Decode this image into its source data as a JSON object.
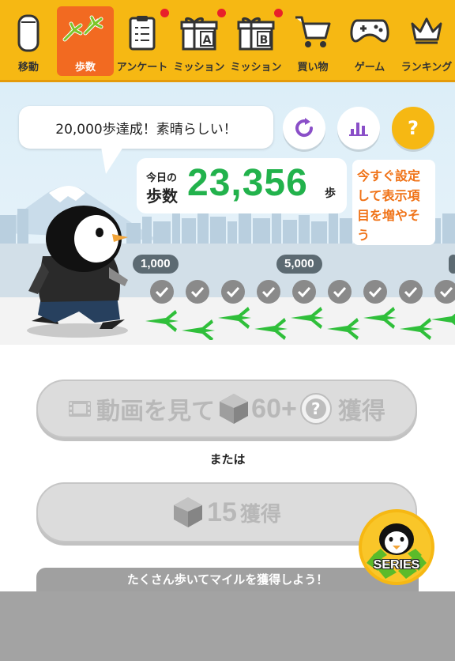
{
  "tabs": [
    {
      "label": "移動",
      "icon": "phone-icon"
    },
    {
      "label": "歩数",
      "icon": "footprints-icon",
      "active": true
    },
    {
      "label": "アンケート",
      "icon": "clipboard-icon",
      "badge": true
    },
    {
      "label": "ミッション",
      "icon": "gift-a-icon",
      "badge": true
    },
    {
      "label": "ミッション",
      "icon": "gift-b-icon",
      "badge": true
    },
    {
      "label": "買い物",
      "icon": "cart-icon"
    },
    {
      "label": "ゲーム",
      "icon": "gamepad-icon"
    },
    {
      "label": "ランキング",
      "icon": "crown-icon"
    }
  ],
  "bubble": {
    "text": "20,000歩達成！素晴らしい！"
  },
  "steps": {
    "label_line1": "今日の",
    "label_line2": "歩数",
    "value": "23,356",
    "unit": "歩"
  },
  "buttons": {
    "refresh_icon": "refresh-icon",
    "stats_icon": "bar-chart-icon",
    "help_label": "?"
  },
  "hint": {
    "line1": "今すぐ設定",
    "line2": "して表示項",
    "line3": "目を増やそ",
    "line4": "う"
  },
  "milestones": {
    "m1": "1,000",
    "m2": "5,000"
  },
  "video_button": {
    "label_prefix": "動画を見て",
    "amount": "60+",
    "help": "?",
    "suffix": "獲得"
  },
  "or_text": "または",
  "gem_button": {
    "amount": "15",
    "suffix": "獲得"
  },
  "banner": {
    "text": "たくさん歩いてマイルを獲得しよう！"
  },
  "series_badge": {
    "label": "SERIES"
  },
  "colors": {
    "accent": "#f6b813",
    "active_tab": "#f26a21",
    "steps_green": "#22b24c",
    "hint_orange": "#f07318"
  }
}
